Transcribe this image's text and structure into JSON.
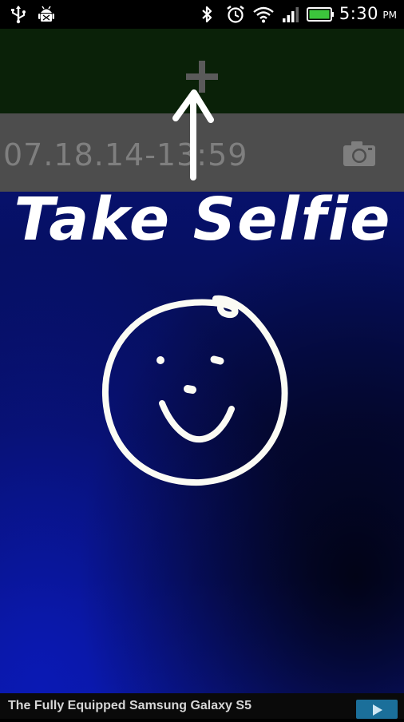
{
  "status_bar": {
    "time": "5:30",
    "ampm": "PM",
    "icons": [
      "usb-icon",
      "android-debug-icon",
      "bluetooth-icon",
      "alarm-icon",
      "wifi-icon",
      "signal-icon",
      "battery-icon"
    ],
    "battery_color": "#3cc43c"
  },
  "add_bar": {
    "icon": "plus-icon",
    "color": "#0a2108"
  },
  "entry": {
    "title": "07.18.14-13:59",
    "icon": "camera-icon"
  },
  "overlay": {
    "caption": "Take Selfie",
    "drawing": "smiley-face-drawing",
    "pointer": "up-arrow-annotation"
  },
  "ad": {
    "text": "The Fully Equipped Samsung Galaxy S5",
    "button_icon": "play-icon",
    "button_color": "#1b6f9a"
  }
}
